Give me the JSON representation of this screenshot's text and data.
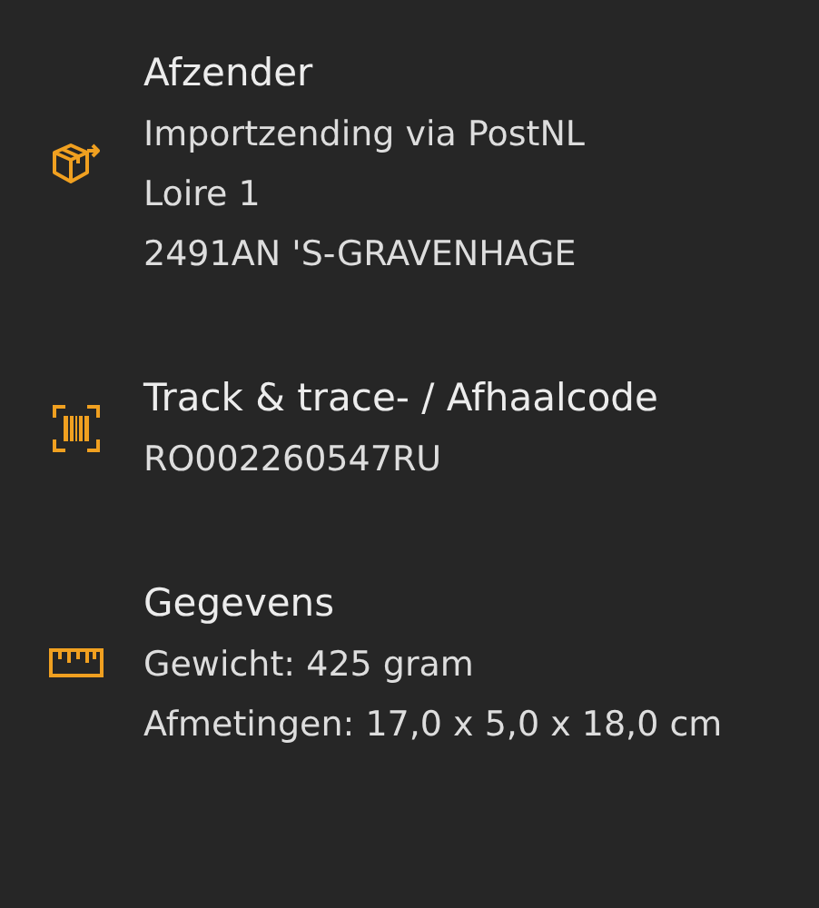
{
  "sections": [
    {
      "kind": "package",
      "title": "Afzender",
      "lines": [
        "Importzending via PostNL",
        "Loire 1",
        "2491AN 'S-GRAVENHAGE"
      ]
    },
    {
      "kind": "barcode",
      "title": "Track & trace- / Afhaalcode",
      "lines": [
        "RO002260547RU"
      ]
    },
    {
      "kind": "ruler",
      "title": "Gegevens",
      "lines": [
        "Gewicht: 425 gram",
        "Afmetingen: 17,0 x 5,0 x 18,0 cm"
      ]
    }
  ]
}
